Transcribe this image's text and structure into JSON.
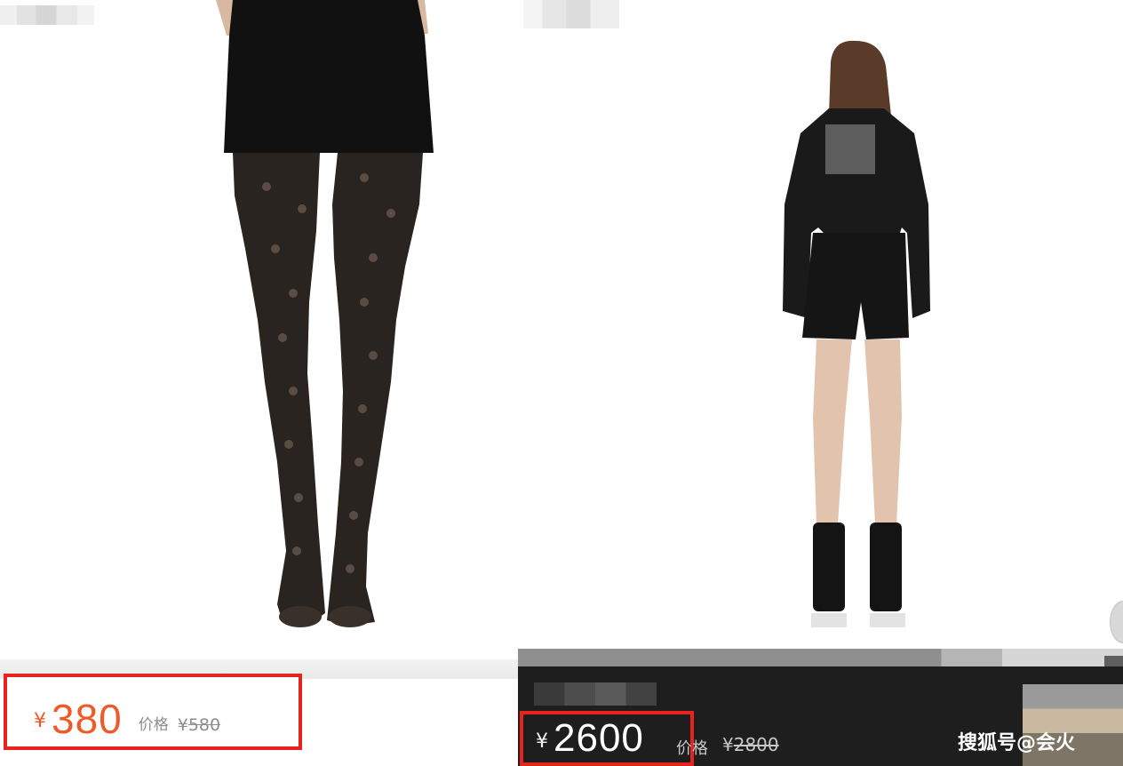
{
  "left_product": {
    "price": {
      "currency": "¥",
      "amount": "380"
    },
    "original_price": {
      "label": "价格",
      "currency": "¥",
      "amount": "580"
    }
  },
  "right_product": {
    "price": {
      "currency": "¥",
      "amount": "2600"
    },
    "original_price": {
      "label": "价格",
      "currency": "¥",
      "amount": "2800"
    }
  },
  "watermark": {
    "text": "搜狐号@会火"
  },
  "colors": {
    "price_orange": "#f05a28",
    "highlight_red": "#e8231e",
    "dark_bar": "#1e1e1e"
  },
  "icons": {
    "nav": "chevron-right-icon"
  }
}
